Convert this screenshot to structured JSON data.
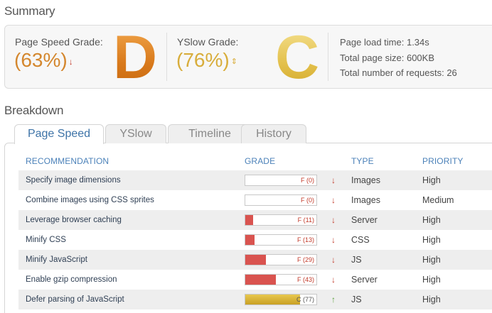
{
  "summary": {
    "title": "Summary",
    "page_speed": {
      "label": "Page Speed Grade:",
      "percent": "(63%)",
      "letter": "D",
      "trend": "down"
    },
    "yslow": {
      "label": "YSlow Grade:",
      "percent": "(76%)",
      "letter": "C",
      "trend": "updown"
    },
    "stats": [
      {
        "label": "Page load time:",
        "value": "1.34s"
      },
      {
        "label": "Total page size:",
        "value": "600KB"
      },
      {
        "label": "Total number of requests:",
        "value": "26"
      }
    ]
  },
  "breakdown": {
    "title": "Breakdown",
    "tabs": [
      "Page Speed",
      "YSlow",
      "Timeline",
      "History"
    ],
    "active_tab": "Page Speed",
    "headers": {
      "recommendation": "RECOMMENDATION",
      "grade": "GRADE",
      "type": "TYPE",
      "priority": "PRIORITY"
    },
    "rows": [
      {
        "recommendation": "Specify image dimensions",
        "grade_text": "F (0)",
        "score": 0,
        "trend": "down",
        "type": "Images",
        "priority": "High"
      },
      {
        "recommendation": "Combine images using CSS sprites",
        "grade_text": "F (0)",
        "score": 0,
        "trend": "down",
        "type": "Images",
        "priority": "Medium"
      },
      {
        "recommendation": "Leverage browser caching",
        "grade_text": "F (11)",
        "score": 11,
        "trend": "down",
        "type": "Server",
        "priority": "High"
      },
      {
        "recommendation": "Minify CSS",
        "grade_text": "F (13)",
        "score": 13,
        "trend": "down",
        "type": "CSS",
        "priority": "High"
      },
      {
        "recommendation": "Minify JavaScript",
        "grade_text": "F (29)",
        "score": 29,
        "trend": "down",
        "type": "JS",
        "priority": "High"
      },
      {
        "recommendation": "Enable gzip compression",
        "grade_text": "F (43)",
        "score": 43,
        "trend": "down",
        "type": "Server",
        "priority": "High"
      },
      {
        "recommendation": "Defer parsing of JavaScript",
        "grade_text": "C (77)",
        "score": 77,
        "trend": "up",
        "type": "JS",
        "priority": "High"
      }
    ]
  },
  "colors": {
    "grade_d": "#d97f23",
    "grade_c": "#e3c04c",
    "fail_bar": "#d9534f",
    "c_bar": "#d4ab2d",
    "header_blue": "#4c82b9"
  }
}
